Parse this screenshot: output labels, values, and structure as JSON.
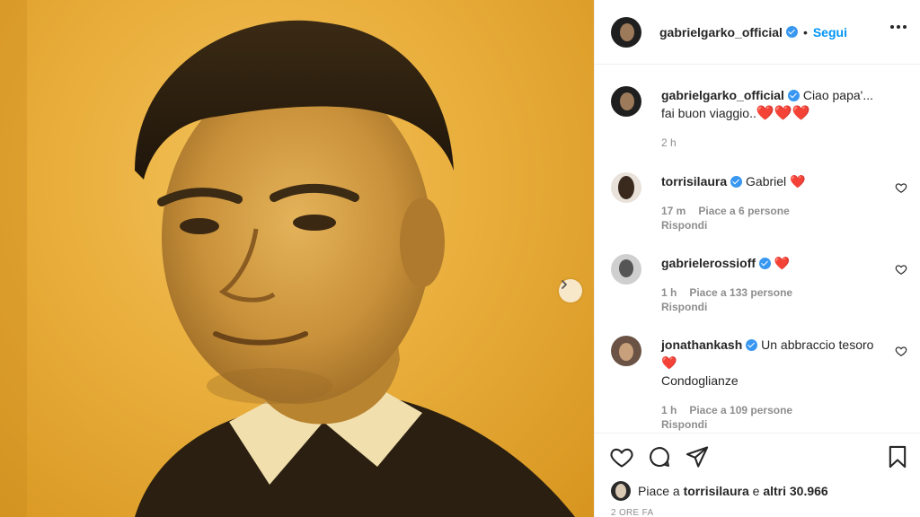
{
  "post": {
    "author": "gabrielgarko_official",
    "follow_label": "Segui",
    "separator": "•",
    "caption_line1": "Ciao papa'...",
    "caption_line2": "fai buon viaggio..",
    "caption_hearts": "❤️❤️❤️",
    "caption_time": "2 h"
  },
  "comments": [
    {
      "username": "torrisilaura",
      "text": "Gabriel ❤️",
      "time": "17 m",
      "likes": "Piace a 6 persone",
      "reply": "Rispondi"
    },
    {
      "username": "gabrielerossioff",
      "text": "❤️",
      "time": "1 h",
      "likes": "Piace a 133 persone",
      "reply": "Rispondi"
    },
    {
      "username": "jonathankash",
      "text": "Un abbraccio tesoro ❤️",
      "text_line2": "Condoglianze",
      "time": "1 h",
      "likes": "Piace a 109 persone",
      "reply": "Rispondi"
    }
  ],
  "footer": {
    "likes_prefix": "Piace a",
    "likes_user": "torrisilaura",
    "likes_middle": "e",
    "likes_others": "altri 30.966",
    "time_ago": "2 ORE FA"
  },
  "icons": {
    "like": "heart-outline-icon",
    "comment": "comment-bubble-icon",
    "share": "paper-plane-icon",
    "save": "bookmark-icon",
    "more": "more-dots-icon",
    "next": "chevron-right-icon"
  },
  "colors": {
    "accent": "#0095f6",
    "verified": "#3897f0",
    "heart": "#ed2a3e",
    "photo_tint": "#e9ae3c"
  }
}
